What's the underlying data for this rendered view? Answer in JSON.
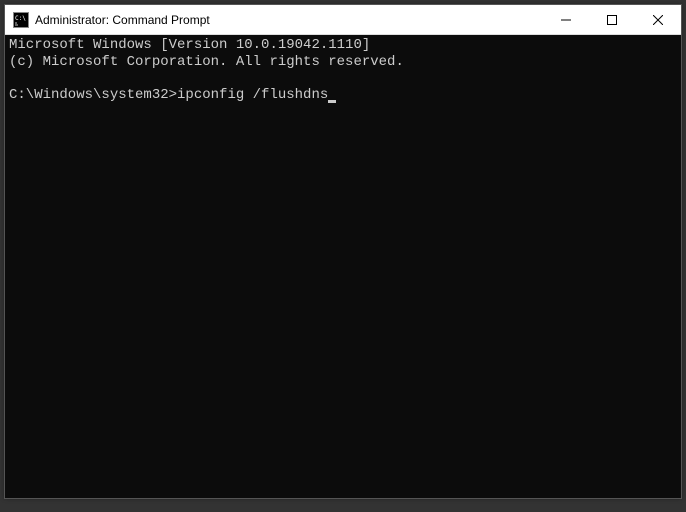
{
  "window": {
    "title": "Administrator: Command Prompt"
  },
  "terminal": {
    "line1": "Microsoft Windows [Version 10.0.19042.1110]",
    "line2": "(c) Microsoft Corporation. All rights reserved.",
    "blank": "",
    "prompt": "C:\\Windows\\system32>",
    "command": "ipconfig /flushdns"
  }
}
